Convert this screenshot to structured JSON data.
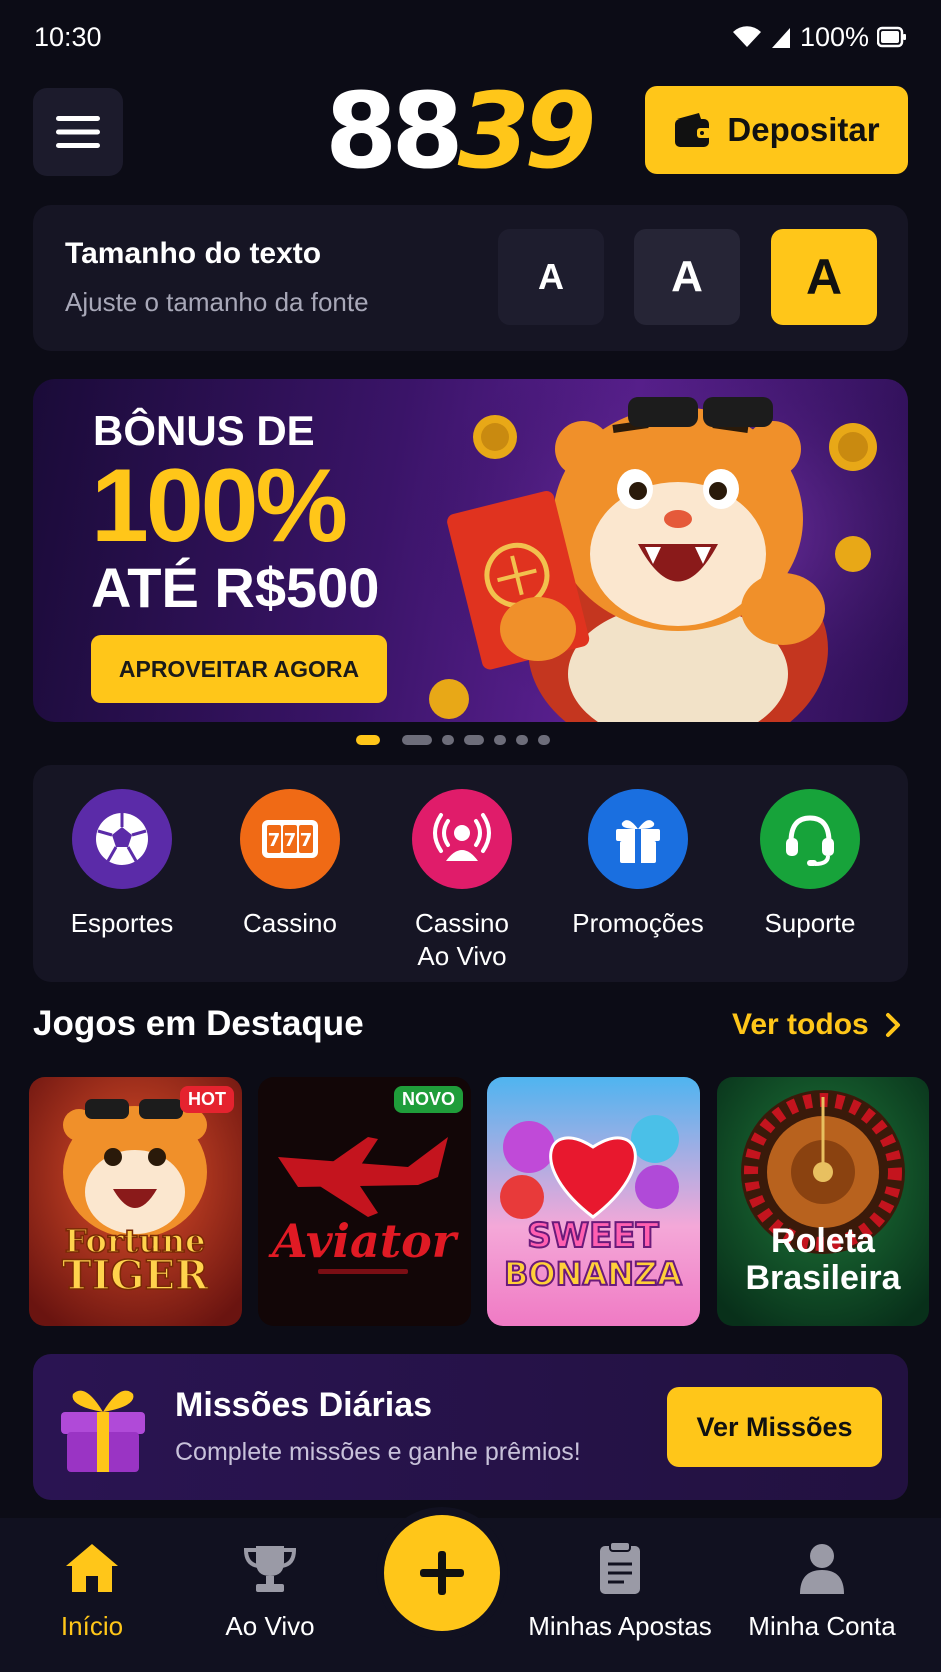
{
  "status_bar": {
    "time": "10:30",
    "battery": "100%"
  },
  "header": {
    "logo_white": "88",
    "logo_yellow": "39",
    "deposit_label": "Depositar"
  },
  "text_size": {
    "title": "Tamanho do texto",
    "subtitle": "Ajuste o tamanho da fonte",
    "options": [
      "A",
      "A",
      "A"
    ],
    "selected_index": 2
  },
  "banner": {
    "line1": "BÔNUS DE",
    "line2": "100%",
    "line3": "ATÉ R$500",
    "cta": "APROVEITAR AGORA",
    "slides": 7,
    "active_slide": 0
  },
  "categories": [
    {
      "label": "Esportes",
      "icon": "soccer-ball-icon",
      "color": "#5b2ba8"
    },
    {
      "label": "Cassino",
      "icon": "slot-777-icon",
      "color": "#f06a15"
    },
    {
      "label": "Cassino Ao Vivo",
      "icon": "live-dealer-icon",
      "color": "#e01c6a"
    },
    {
      "label": "Promoções",
      "icon": "gift-icon",
      "color": "#1a6fe0"
    },
    {
      "label": "Suporte",
      "icon": "headset-icon",
      "color": "#17a33a"
    }
  ],
  "featured": {
    "title": "Jogos em Destaque",
    "see_all": "Ver todos",
    "games": [
      {
        "name_line1": "Fortune",
        "name_line2": "TIGER",
        "badge": "HOT",
        "badge_color": "#e5232f"
      },
      {
        "name_line1": "Aviator",
        "name_line2": "",
        "badge": "NOVO",
        "badge_color": "#1f9d3a"
      },
      {
        "name_line1": "SWEET",
        "name_line2": "BONANZA",
        "badge": "",
        "badge_color": ""
      },
      {
        "name_line1": "Roleta",
        "name_line2": "Brasileira",
        "badge": "",
        "badge_color": ""
      }
    ]
  },
  "missions": {
    "title": "Missões Diárias",
    "subtitle": "Complete missões e ganhe prêmios!",
    "cta": "Ver Missões"
  },
  "bottom_nav": [
    {
      "label": "Início",
      "icon": "home-icon",
      "active": true
    },
    {
      "label": "Ao Vivo",
      "icon": "trophy-icon",
      "active": false
    },
    {
      "label": "Minhas Apostas",
      "icon": "clipboard-icon",
      "active": false
    },
    {
      "label": "Minha Conta",
      "icon": "user-icon",
      "active": false
    }
  ],
  "colors": {
    "accent": "#ffc619",
    "background": "#0c0c16",
    "card": "#161524"
  }
}
